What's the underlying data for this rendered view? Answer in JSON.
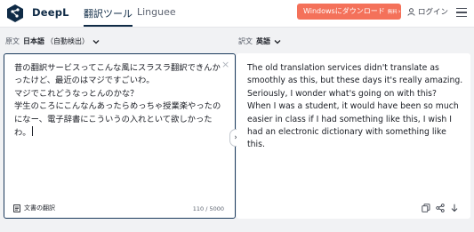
{
  "header": {
    "brand": "DeepL",
    "nav_translator": "翻訳ツール",
    "nav_linguee": "Linguee",
    "download_button": "Windowsにダウンロード",
    "download_badge": "無料",
    "download_arrow": "›",
    "login_label": "ログイン"
  },
  "source": {
    "prefix": "原文",
    "language": "日本語",
    "detect_label": "（自動検出）",
    "text": "昔の翻訳サービスってこんな風にスラスラ翻訳できんかったけど、最近のはマジですごいわ。\nマジでこれどうなっとんのかな？\n学生のころにこんなんあったらめっちゃ授業楽やったのになー、電子辞書にこういうの入れといて欲しかったわ。",
    "clear_symbol": "×",
    "document_button": "文書の翻訳",
    "char_count": "110 / 5000"
  },
  "swap_symbol": "›",
  "target": {
    "prefix": "訳文",
    "language": "英語",
    "text": "The old translation services didn't translate as smoothly as this, but these days it's really amazing.\nSeriously, I wonder what's going on with this?\nWhen I was a student, it would have been so much easier in class if I had something like this, I wish I had an electronic dictionary with something like this."
  },
  "colors": {
    "brand_navy": "#0f2b46",
    "download_orange": "#f4715a",
    "background": "#f1f2f4",
    "panel": "#ffffff"
  },
  "icons": [
    "deepl-logo-icon",
    "user-icon",
    "hamburger-menu-icon",
    "chevron-down-icon",
    "close-icon",
    "document-icon",
    "swap-chevron-icon",
    "copy-icon",
    "share-icon",
    "download-icon"
  ]
}
